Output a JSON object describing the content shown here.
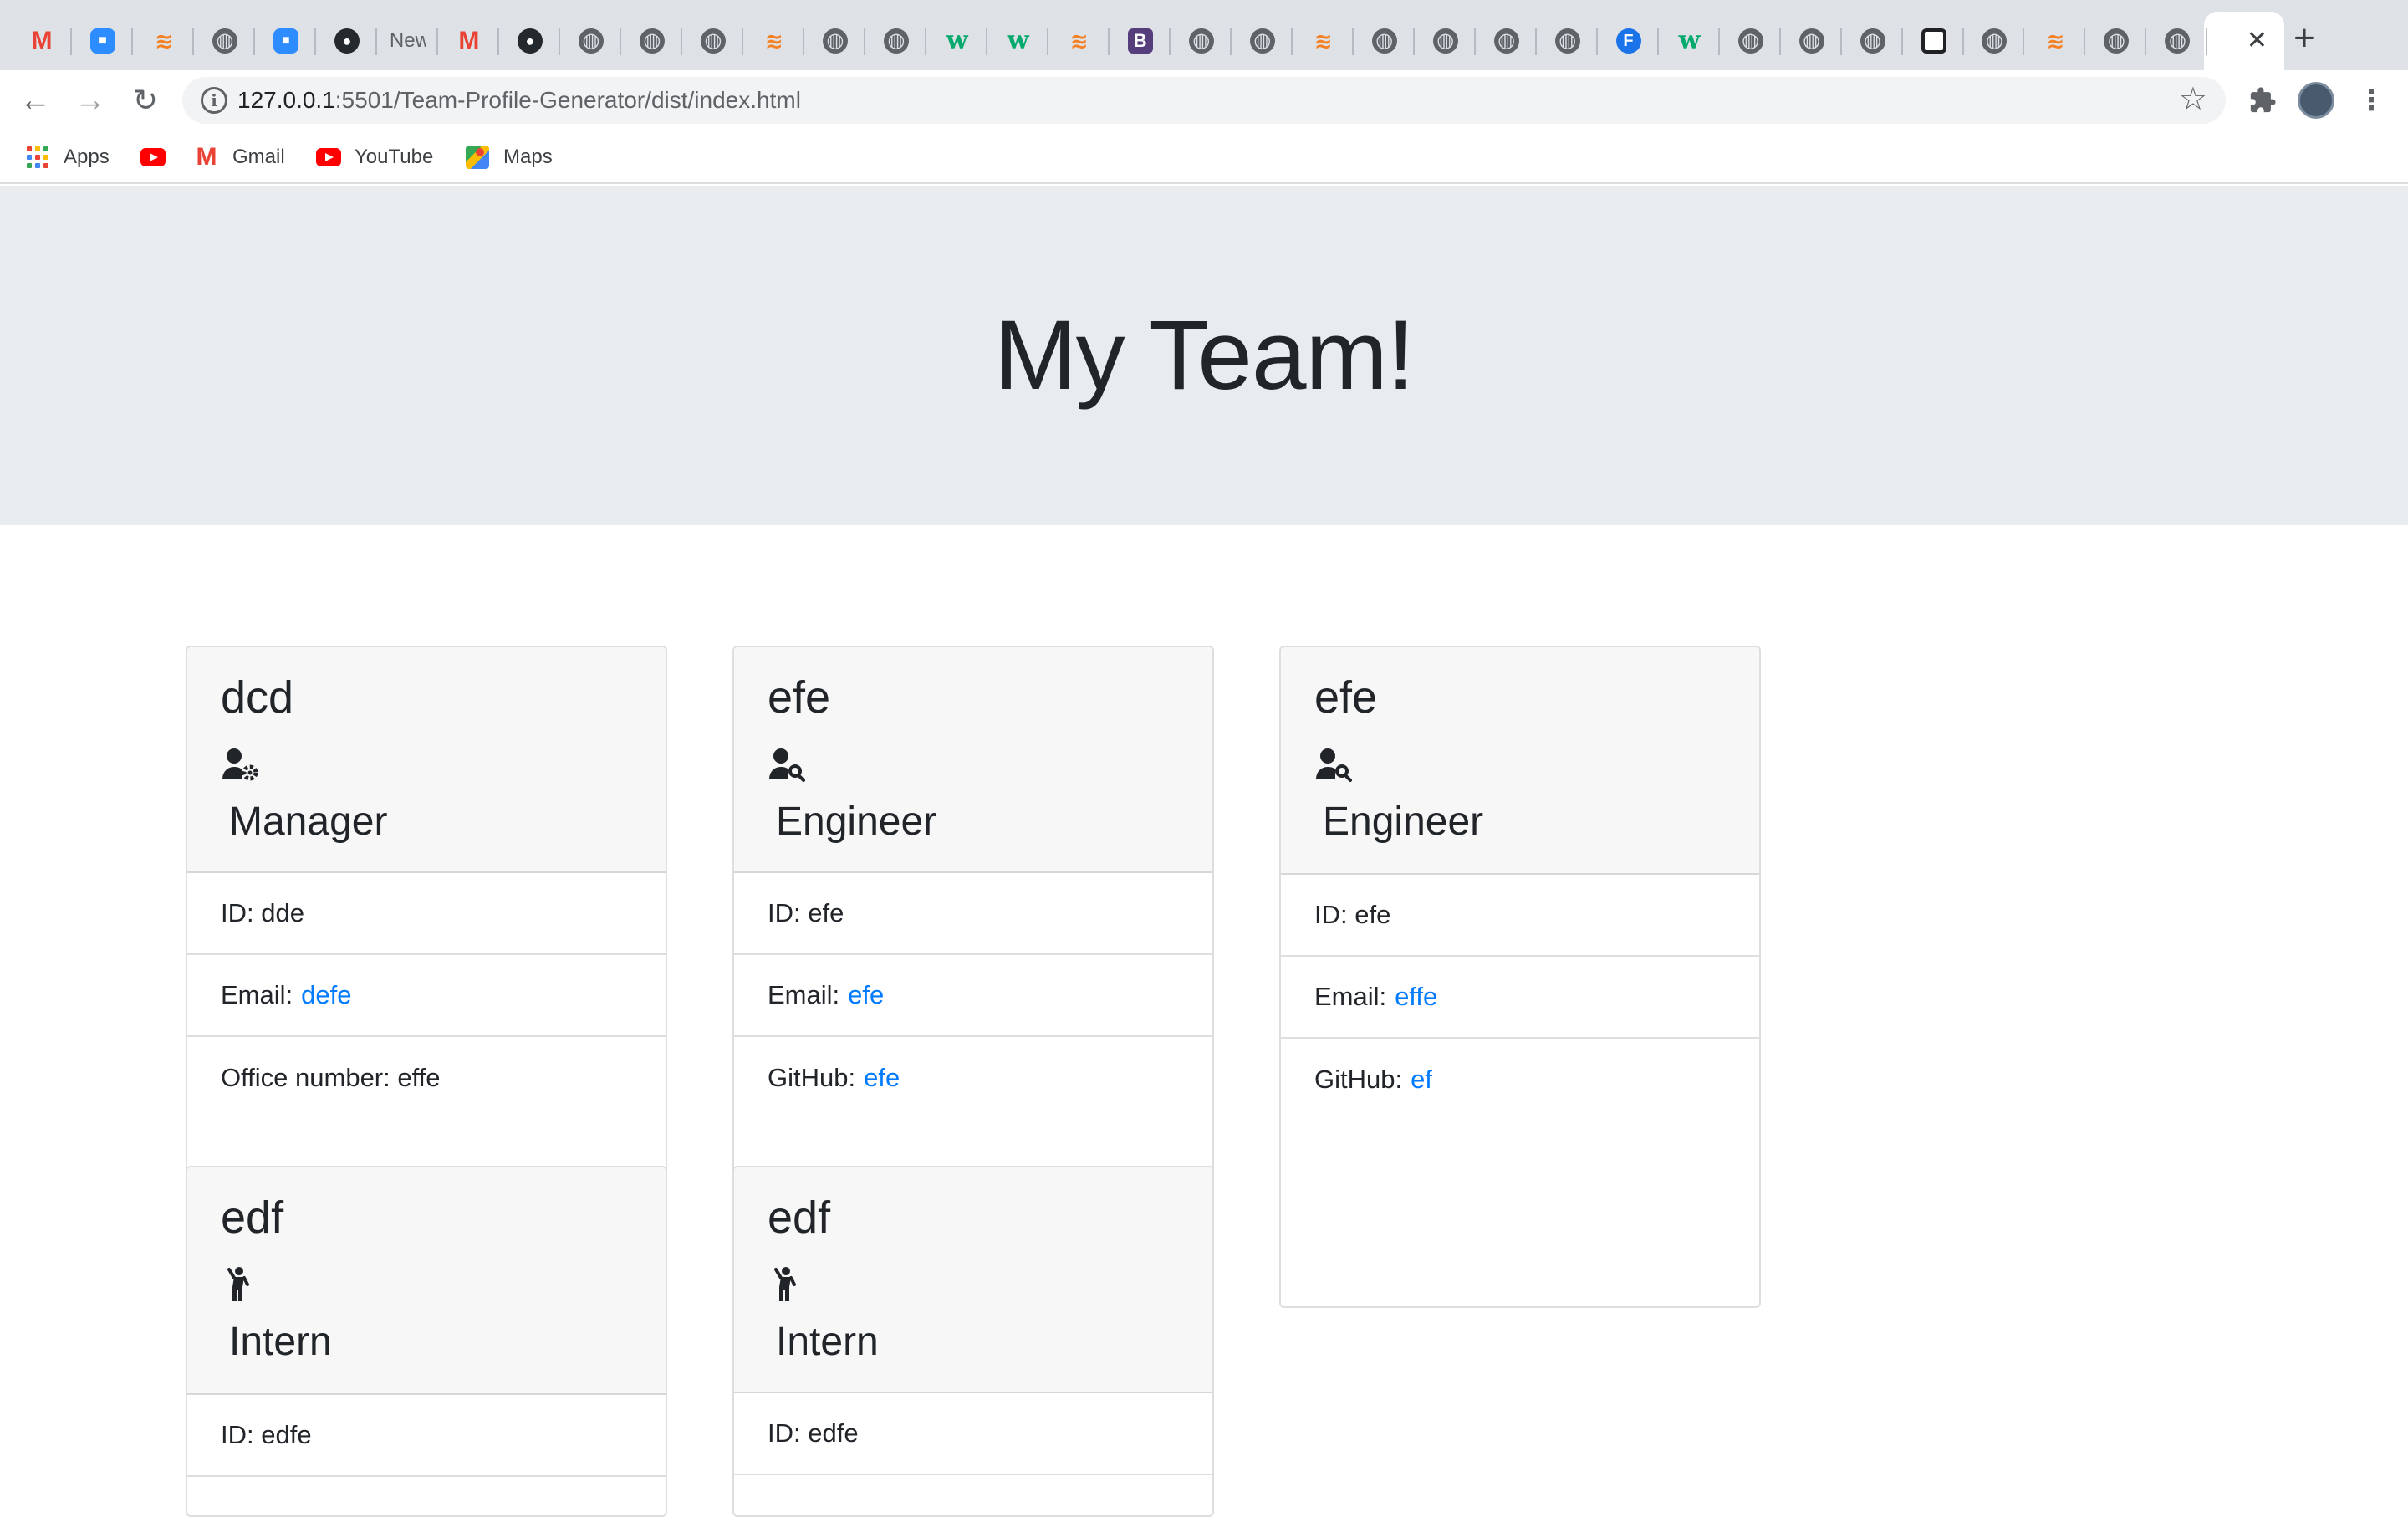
{
  "browser": {
    "tabs": [
      {
        "icon": "gmail-icon"
      },
      {
        "icon": "zoom-icon"
      },
      {
        "icon": "stackoverflow-icon"
      },
      {
        "icon": "globe-icon"
      },
      {
        "icon": "zoom-icon"
      },
      {
        "icon": "github-icon"
      },
      {
        "icon": "text-tab",
        "text": "New"
      },
      {
        "icon": "gmail-icon"
      },
      {
        "icon": "github-icon"
      },
      {
        "icon": "globe-icon"
      },
      {
        "icon": "globe-icon"
      },
      {
        "icon": "globe-icon"
      },
      {
        "icon": "stackoverflow-icon"
      },
      {
        "icon": "globe-icon"
      },
      {
        "icon": "globe-icon"
      },
      {
        "icon": "w3schools-icon"
      },
      {
        "icon": "w3schools-icon"
      },
      {
        "icon": "stackoverflow-icon"
      },
      {
        "icon": "bootstrap-icon"
      },
      {
        "icon": "globe-icon"
      },
      {
        "icon": "globe-icon"
      },
      {
        "icon": "stackoverflow-icon"
      },
      {
        "icon": "globe-icon"
      },
      {
        "icon": "globe-icon"
      },
      {
        "icon": "globe-icon"
      },
      {
        "icon": "globe-icon"
      },
      {
        "icon": "f-icon"
      },
      {
        "icon": "w3schools-icon"
      },
      {
        "icon": "globe-icon"
      },
      {
        "icon": "globe-icon"
      },
      {
        "icon": "globe-icon"
      },
      {
        "icon": "box-icon"
      },
      {
        "icon": "globe-icon"
      },
      {
        "icon": "stackoverflow-icon"
      },
      {
        "icon": "globe-icon"
      },
      {
        "icon": "globe-icon"
      }
    ],
    "address": {
      "host": "127.0.0.1",
      "path": ":5501/Team-Profile-Generator/dist/index.html"
    },
    "bookmarks": {
      "apps": "Apps",
      "gmail": "Gmail",
      "youtube": "YouTube",
      "maps": "Maps"
    }
  },
  "page": {
    "title": "My Team!",
    "cards": [
      {
        "name": "dcd",
        "role": "Manager",
        "icon": "manager-icon",
        "id_label": "ID:",
        "id": "dde",
        "email_label": "Email:",
        "email": "defe",
        "extra_label": "Office number:",
        "extra": "effe",
        "extra_is_link": false
      },
      {
        "name": "efe",
        "role": "Engineer",
        "icon": "engineer-icon",
        "id_label": "ID:",
        "id": "efe",
        "email_label": "Email:",
        "email": "efe",
        "extra_label": "GitHub:",
        "extra": "efe",
        "extra_is_link": true
      },
      {
        "name": "efe",
        "role": "Engineer",
        "icon": "engineer-icon",
        "id_label": "ID:",
        "id": "efe",
        "email_label": "Email:",
        "email": "effe",
        "extra_label": "GitHub:",
        "extra": "ef",
        "extra_is_link": true
      },
      {
        "name": "edf",
        "role": "Intern",
        "icon": "intern-icon",
        "id_label": "ID:",
        "id": "edfe"
      },
      {
        "name": "edf",
        "role": "Intern",
        "icon": "intern-icon",
        "id_label": "ID:",
        "id": "edfe"
      }
    ]
  },
  "colors": {
    "link": "#007bff",
    "jumbotron": "#e9ecef",
    "card_header": "#f7f7f7",
    "tabstrip": "#dee1e6"
  }
}
